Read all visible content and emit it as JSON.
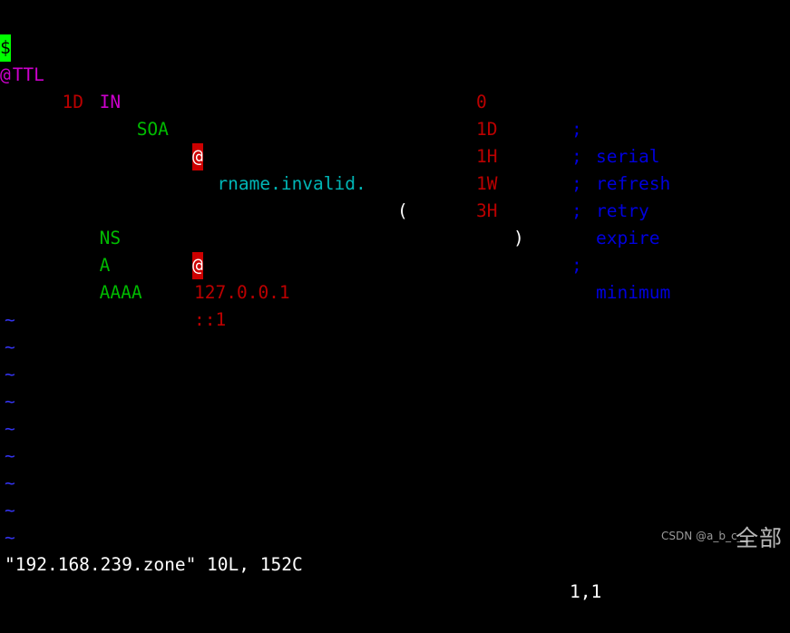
{
  "editor": {
    "app": "vim",
    "filename": "192.168.239.zone",
    "background": "#000000",
    "foreground": "#ffffff",
    "cursor_bg": "#00ff00",
    "char_width": 13.7,
    "line_height": 30
  },
  "zone_file": {
    "line1": {
      "cursor_char": "$",
      "directive": "TTL",
      "value": "1D"
    },
    "line2": {
      "owner": "@",
      "class": "IN",
      "type": "SOA",
      "mname_cursor": "@",
      "rname": "rname.invalid.",
      "open_paren": "("
    },
    "soa_params": [
      {
        "value": "0",
        "semicolon": ";",
        "comment": "serial",
        "close_paren": ""
      },
      {
        "value": "1D",
        "semicolon": ";",
        "comment": "refresh",
        "close_paren": ""
      },
      {
        "value": "1H",
        "semicolon": ";",
        "comment": "retry",
        "close_paren": ""
      },
      {
        "value": "1W",
        "semicolon": ";",
        "comment": "expire",
        "close_paren": ""
      },
      {
        "value": "3H",
        "semicolon": ";",
        "comment": "minimum",
        "close_paren": ")"
      }
    ],
    "records": [
      {
        "type": "NS",
        "value": "@",
        "value_is_cursor": true
      },
      {
        "type": "A",
        "value": "127.0.0.1",
        "value_is_cursor": false
      },
      {
        "type": "AAAA",
        "value": "::1",
        "value_is_cursor": false
      }
    ],
    "empty_line_markers": [
      "~",
      "~",
      "~",
      "~",
      "~",
      "~",
      "~",
      "~",
      "~"
    ]
  },
  "statusline": {
    "file_info": "\"192.168.239.zone\" 10L, 152C",
    "cursor_position": "1,1"
  },
  "watermark": {
    "label": "CSDN @a_b_c__",
    "overlay": "全部"
  },
  "colors": {
    "directive": "#cc00cc",
    "type": "#00bb00",
    "number": "#bb0000",
    "comment": "#0000dd",
    "rname": "#00b6b6",
    "tilde": "#3333ee",
    "cursor_green": "#00ff00",
    "cursor_red": "#cc0000"
  }
}
